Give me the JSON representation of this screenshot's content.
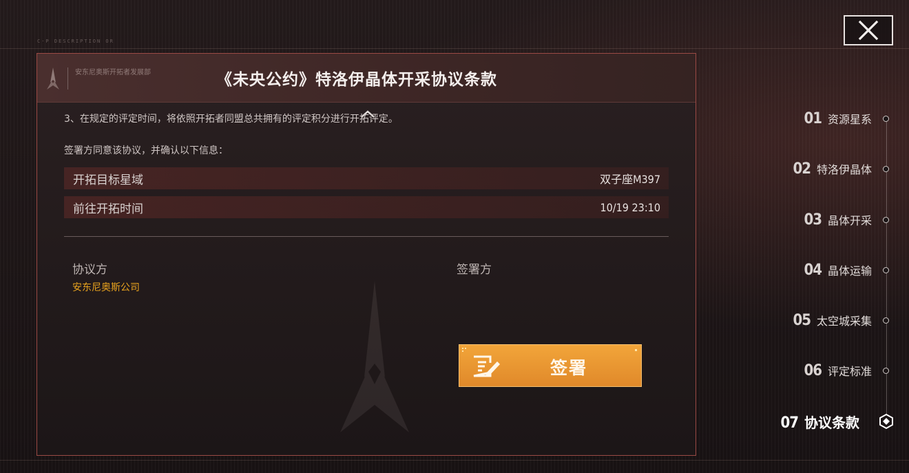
{
  "background": {
    "deco_text": "C·P DESCRIPTION OR"
  },
  "dialog": {
    "department": "安东尼奥斯开拓者发展部",
    "title": "《未央公约》特洛伊晶体开采协议条款",
    "clause_text": "3、在规定的评定时间，将依照开拓者同盟总共拥有的评定积分进行开拓评定。",
    "confirm_text": "签署方同意该协议，并确认以下信息：",
    "info_rows": [
      {
        "label": "开拓目标星域",
        "value": "双子座M397"
      },
      {
        "label": "前往开拓时间",
        "value": "10/19 23:10"
      }
    ],
    "party_a_label": "协议方",
    "party_a_name": "安东尼奥斯公司",
    "party_b_label": "签署方",
    "sign_button": "签署"
  },
  "nav": {
    "items": [
      {
        "num": "01",
        "label": "资源星系"
      },
      {
        "num": "02",
        "label": "特洛伊晶体"
      },
      {
        "num": "03",
        "label": "晶体开采"
      },
      {
        "num": "04",
        "label": "晶体运输"
      },
      {
        "num": "05",
        "label": "太空城采集"
      },
      {
        "num": "06",
        "label": "评定标准"
      },
      {
        "num": "07",
        "label": "协议条款"
      }
    ],
    "active_index": 6
  },
  "colors": {
    "accent_orange": "#e8a21e",
    "button_orange": "#eb9a33",
    "border_red": "#9b4a45"
  },
  "icons": {
    "close": "close-icon",
    "sign": "edit-document-icon",
    "active_nav": "hexagon-marker-icon"
  }
}
